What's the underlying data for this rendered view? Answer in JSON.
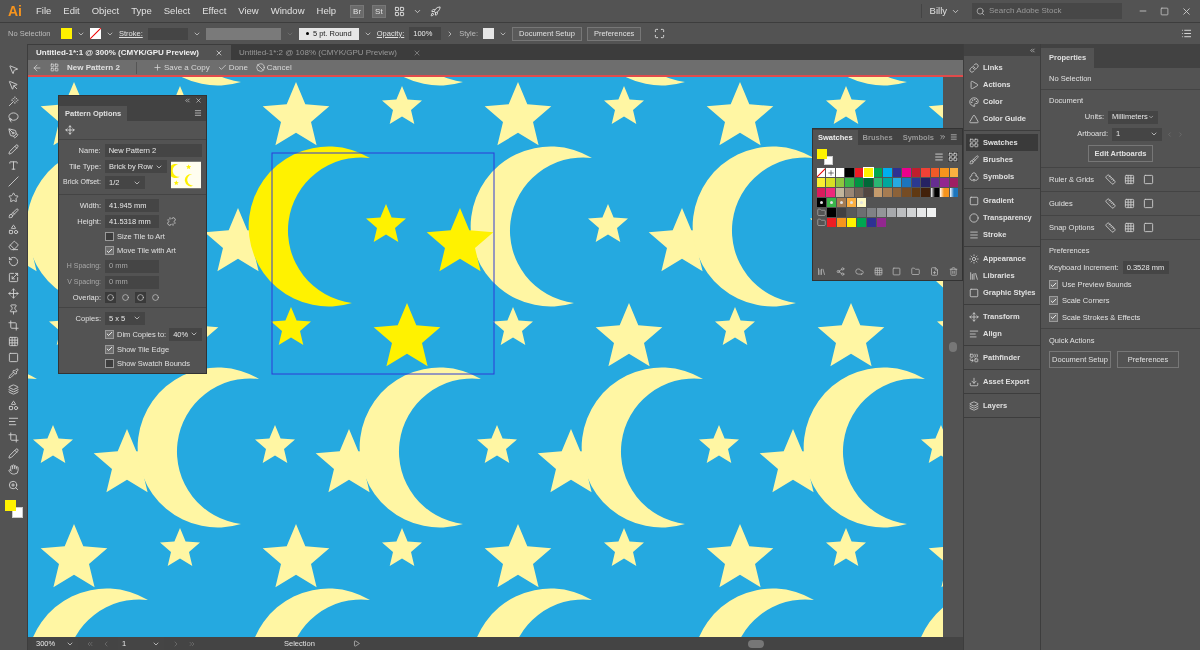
{
  "app": {
    "logo": "Ai"
  },
  "menu": [
    "File",
    "Edit",
    "Object",
    "Type",
    "Select",
    "Effect",
    "View",
    "Window",
    "Help"
  ],
  "bridge_badges": [
    "Br",
    "St"
  ],
  "account": {
    "user": "Billy",
    "search_placeholder": "Search Adobe Stock"
  },
  "control_bar": {
    "selection": "No Selection",
    "stroke_label": "Stroke:",
    "brush": "5 pt. Round",
    "opacity_label": "Opacity:",
    "opacity": "100%",
    "style_label": "Style:",
    "buttons": [
      "Document Setup",
      "Preferences"
    ]
  },
  "documents": [
    {
      "title": "Untitled-1*:1 @ 300% (CMYK/GPU Preview)",
      "selected": true
    },
    {
      "title": "Untitled-1*:2 @ 108% (CMYK/GPU Preview)",
      "selected": false
    }
  ],
  "pattern_bar": {
    "name": "New Pattern 2",
    "actions": [
      {
        "kind": "add",
        "label": "Save a Copy"
      },
      {
        "kind": "done",
        "label": "Done"
      },
      {
        "kind": "cancel",
        "label": "Cancel"
      }
    ]
  },
  "pattern_options": {
    "title": "Pattern Options",
    "name_label": "Name:",
    "name": "New Pattern 2",
    "tile_type_label": "Tile Type:",
    "tile_type": "Brick by Row",
    "brick_offset_label": "Brick Offset:",
    "brick_offset": "1/2",
    "width_label": "Width:",
    "width": "41.945 mm",
    "height_label": "Height:",
    "height": "41.5318 mm",
    "tile_options": [
      {
        "label": "Size Tile to Art",
        "checked": false
      },
      {
        "label": "Move Tile with Art",
        "checked": true
      }
    ],
    "h_spacing_label": "H Spacing:",
    "h_spacing": "0 mm",
    "v_spacing_label": "V Spacing:",
    "v_spacing": "0 mm",
    "spacing_disabled": true,
    "overlap_label": "Overlap:",
    "copies_label": "Copies:",
    "copies": "5 x 5",
    "dim": {
      "label": "Dim Copies to:",
      "checked": true,
      "value": "40%"
    },
    "display_options": [
      {
        "label": "Show Tile Edge",
        "checked": true
      },
      {
        "label": "Show Swatch Bounds",
        "checked": false
      }
    ]
  },
  "swatches_panel": {
    "tabs": [
      {
        "label": "Swatches",
        "selected": true
      },
      {
        "label": "Brushes",
        "selected": false
      },
      {
        "label": "Symbols",
        "selected": false
      }
    ],
    "rows": [
      [
        {
          "kind": "none",
          "selected": false
        },
        {
          "kind": "registration",
          "selected": false
        },
        {
          "kind": "color",
          "color": "#ffffff",
          "selected": false
        },
        {
          "kind": "color",
          "color": "#000000",
          "selected": false
        },
        {
          "kind": "color",
          "color": "#ed1c24",
          "selected": false
        },
        {
          "kind": "color",
          "color": "#fff200",
          "selected": true
        },
        {
          "kind": "color",
          "color": "#00a651",
          "selected": false
        },
        {
          "kind": "color",
          "color": "#00aeef",
          "selected": false
        },
        {
          "kind": "color",
          "color": "#2e3192",
          "selected": false
        },
        {
          "kind": "color",
          "color": "#ec008c",
          "selected": false
        },
        {
          "kind": "color",
          "color": "#be1e2d",
          "selected": false
        },
        {
          "kind": "color",
          "color": "#ef4136",
          "selected": false
        },
        {
          "kind": "color",
          "color": "#f15a29",
          "selected": false
        },
        {
          "kind": "color",
          "color": "#f7941d",
          "selected": false
        },
        {
          "kind": "color",
          "color": "#fbb040",
          "selected": false
        }
      ],
      [
        {
          "kind": "color",
          "color": "#f9ed32",
          "selected": false
        },
        {
          "kind": "color",
          "color": "#d7df23",
          "selected": false
        },
        {
          "kind": "color",
          "color": "#8dc63f",
          "selected": false
        },
        {
          "kind": "color",
          "color": "#39b54a",
          "selected": false
        },
        {
          "kind": "color",
          "color": "#009444",
          "selected": false
        },
        {
          "kind": "color",
          "color": "#006838",
          "selected": false
        },
        {
          "kind": "color",
          "color": "#2bb673",
          "selected": false
        },
        {
          "kind": "color",
          "color": "#00a79d",
          "selected": false
        },
        {
          "kind": "color",
          "color": "#27aae1",
          "selected": false
        },
        {
          "kind": "color",
          "color": "#1c75bc",
          "selected": false
        },
        {
          "kind": "color",
          "color": "#2b3990",
          "selected": false
        },
        {
          "kind": "color",
          "color": "#262262",
          "selected": false
        },
        {
          "kind": "color",
          "color": "#662d91",
          "selected": false
        },
        {
          "kind": "color",
          "color": "#92278f",
          "selected": false
        },
        {
          "kind": "color",
          "color": "#9e1f63",
          "selected": false
        }
      ],
      [
        {
          "kind": "color",
          "color": "#da1c5c",
          "selected": false
        },
        {
          "kind": "color",
          "color": "#ee2a7b",
          "selected": false
        },
        {
          "kind": "color",
          "color": "#c2b59b",
          "selected": false
        },
        {
          "kind": "color",
          "color": "#998675",
          "selected": false
        },
        {
          "kind": "color",
          "color": "#736357",
          "selected": false
        },
        {
          "kind": "color",
          "color": "#534741",
          "selected": false
        },
        {
          "kind": "color",
          "color": "#c69c6d",
          "selected": false
        },
        {
          "kind": "color",
          "color": "#a67c52",
          "selected": false
        },
        {
          "kind": "color",
          "color": "#8c6239",
          "selected": false
        },
        {
          "kind": "color",
          "color": "#754c24",
          "selected": false
        },
        {
          "kind": "color",
          "color": "#603913",
          "selected": false
        },
        {
          "kind": "color",
          "color": "#42210b",
          "selected": false
        },
        {
          "kind": "gradient",
          "color": "#000000",
          "selected": false
        },
        {
          "kind": "gradient",
          "color": "#f7941d",
          "selected": false
        },
        {
          "kind": "gradient",
          "color": "#1c75bc",
          "selected": false
        }
      ],
      [
        {
          "kind": "pattern",
          "color": "#000000",
          "selected": false
        },
        {
          "kind": "pattern",
          "color": "#39b54a",
          "selected": false
        },
        {
          "kind": "pattern",
          "color": "#a67c52",
          "selected": false
        },
        {
          "kind": "pattern",
          "color": "#fbb040",
          "selected": false
        },
        {
          "kind": "pattern",
          "color": "#fff9c4",
          "selected": false
        }
      ],
      [
        {
          "kind": "folder",
          "selected": false
        },
        {
          "kind": "color",
          "color": "#000000",
          "selected": false
        },
        {
          "kind": "color",
          "color": "#414042",
          "selected": false
        },
        {
          "kind": "color",
          "color": "#58595b",
          "selected": false
        },
        {
          "kind": "color",
          "color": "#6d6e71",
          "selected": false
        },
        {
          "kind": "color",
          "color": "#808285",
          "selected": false
        },
        {
          "kind": "color",
          "color": "#939598",
          "selected": false
        },
        {
          "kind": "color",
          "color": "#a7a9ac",
          "selected": false
        },
        {
          "kind": "color",
          "color": "#bcbec0",
          "selected": false
        },
        {
          "kind": "color",
          "color": "#d1d3d4",
          "selected": false
        },
        {
          "kind": "color",
          "color": "#e6e7e8",
          "selected": false
        },
        {
          "kind": "color",
          "color": "#f1f2f2",
          "selected": false
        }
      ],
      [
        {
          "kind": "folder",
          "selected": false
        },
        {
          "kind": "color",
          "color": "#ed1c24",
          "selected": false
        },
        {
          "kind": "color",
          "color": "#f7941d",
          "selected": false
        },
        {
          "kind": "color",
          "color": "#fff200",
          "selected": false
        },
        {
          "kind": "color",
          "color": "#00a651",
          "selected": false
        },
        {
          "kind": "color",
          "color": "#2e3192",
          "selected": false
        },
        {
          "kind": "color",
          "color": "#92278f",
          "selected": false
        }
      ]
    ]
  },
  "panel_dock": [
    {
      "items": [
        {
          "label": "Links",
          "selected": false
        },
        {
          "label": "Actions",
          "selected": false
        },
        {
          "label": "Color",
          "selected": false
        },
        {
          "label": "Color Guide",
          "selected": false
        }
      ]
    },
    {
      "items": [
        {
          "label": "Swatches",
          "selected": true
        },
        {
          "label": "Brushes",
          "selected": false
        },
        {
          "label": "Symbols",
          "selected": false
        }
      ]
    },
    {
      "items": [
        {
          "label": "Gradient",
          "selected": false
        },
        {
          "label": "Transparency",
          "selected": false
        },
        {
          "label": "Stroke",
          "selected": false
        }
      ]
    },
    {
      "items": [
        {
          "label": "Appearance",
          "selected": false
        },
        {
          "label": "Libraries",
          "selected": false
        },
        {
          "label": "Graphic Styles",
          "selected": false
        }
      ]
    },
    {
      "items": [
        {
          "label": "Transform",
          "selected": false
        },
        {
          "label": "Align",
          "selected": false
        }
      ]
    },
    {
      "items": [
        {
          "label": "Pathfinder",
          "selected": false
        }
      ]
    },
    {
      "items": [
        {
          "label": "Asset Export",
          "selected": false
        }
      ]
    },
    {
      "items": [
        {
          "label": "Layers",
          "selected": false
        }
      ]
    }
  ],
  "properties": {
    "tab": "Properties",
    "selection": "No Selection",
    "document": {
      "title": "Document",
      "units_label": "Units:",
      "units": "Millimeters",
      "artboard_label": "Artboard:",
      "artboard": "1",
      "button": "Edit Artboards"
    },
    "sections": [
      "Ruler & Grids",
      "Guides",
      "Snap Options"
    ],
    "preferences": {
      "title": "Preferences",
      "increment_label": "Keyboard Increment:",
      "increment": "0.3528 mm",
      "options": [
        {
          "label": "Use Preview Bounds",
          "checked": true
        },
        {
          "label": "Scale Corners",
          "checked": true
        },
        {
          "label": "Scale Strokes & Effects",
          "checked": true
        }
      ]
    },
    "quick_actions": {
      "title": "Quick Actions",
      "buttons": [
        "Document Setup",
        "Preferences"
      ]
    }
  },
  "status_bar": {
    "zoom": "300%",
    "artboard": "1",
    "tool": "Selection"
  }
}
